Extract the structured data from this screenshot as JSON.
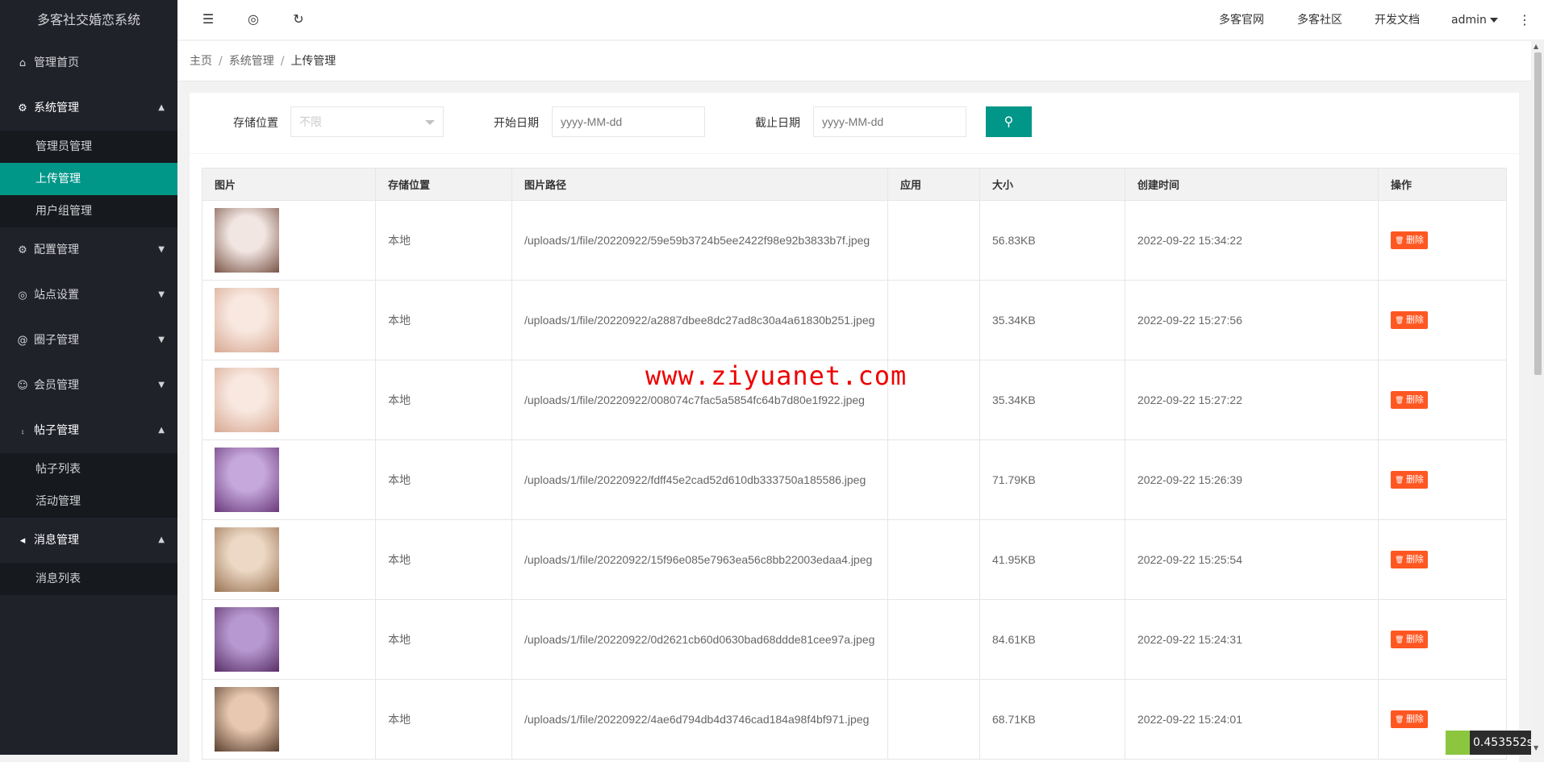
{
  "app": {
    "title": "多客社交婚恋系统"
  },
  "sidebar": {
    "items": [
      {
        "label": "管理首页",
        "icon": "home-icon",
        "expanded": false
      },
      {
        "label": "系统管理",
        "icon": "gear-icon",
        "expanded": true,
        "children": [
          {
            "label": "管理员管理"
          },
          {
            "label": "上传管理",
            "active": true
          },
          {
            "label": "用户组管理"
          }
        ]
      },
      {
        "label": "配置管理",
        "icon": "gear-icon",
        "expanded": false
      },
      {
        "label": "站点设置",
        "icon": "palette-icon",
        "expanded": false
      },
      {
        "label": "圈子管理",
        "icon": "at-icon",
        "expanded": false
      },
      {
        "label": "会员管理",
        "icon": "user-icon",
        "expanded": false
      },
      {
        "label": "帖子管理",
        "icon": "cart-icon",
        "expanded": true,
        "children": [
          {
            "label": "帖子列表"
          },
          {
            "label": "活动管理"
          }
        ]
      },
      {
        "label": "消息管理",
        "icon": "speaker-icon",
        "expanded": true,
        "children": [
          {
            "label": "消息列表"
          }
        ]
      }
    ]
  },
  "header": {
    "links": [
      "多客官网",
      "多客社区",
      "开发文档"
    ],
    "user": "admin"
  },
  "breadcrumb": [
    "主页",
    "系统管理",
    "上传管理"
  ],
  "filters": {
    "storage_label": "存储位置",
    "storage_value": "不限",
    "start_label": "开始日期",
    "start_placeholder": "yyyy-MM-dd",
    "end_label": "截止日期",
    "end_placeholder": "yyyy-MM-dd"
  },
  "table": {
    "columns": [
      "图片",
      "存储位置",
      "图片路径",
      "应用",
      "大小",
      "创建时间",
      "操作"
    ],
    "delete_label": "删除",
    "rows": [
      {
        "storage": "本地",
        "path": "/uploads/1/file/20220922/59e59b3724b5ee2422f98e92b3833b7f.jpeg",
        "app": "",
        "size": "56.83KB",
        "created": "2022-09-22 15:34:22",
        "thumb": [
          "#f2e6e2",
          "#7a5548"
        ]
      },
      {
        "storage": "本地",
        "path": "/uploads/1/file/20220922/a2887dbee8dc27ad8c30a4a61830b251.jpeg",
        "app": "",
        "size": "35.34KB",
        "created": "2022-09-22 15:27:56",
        "thumb": [
          "#f8e8e0",
          "#d8a892"
        ]
      },
      {
        "storage": "本地",
        "path": "/uploads/1/file/20220922/008074c7fac5a5854fc64b7d80e1f922.jpeg",
        "app": "",
        "size": "35.34KB",
        "created": "2022-09-22 15:27:22",
        "thumb": [
          "#f8e8e0",
          "#d8a892"
        ]
      },
      {
        "storage": "本地",
        "path": "/uploads/1/file/20220922/fdff45e2cad52d610db333750a185586.jpeg",
        "app": "",
        "size": "71.79KB",
        "created": "2022-09-22 15:26:39",
        "thumb": [
          "#c6a8dc",
          "#6a3a7a"
        ]
      },
      {
        "storage": "本地",
        "path": "/uploads/1/file/20220922/15f96e085e7963ea56c8bb22003edaa4.jpeg",
        "app": "",
        "size": "41.95KB",
        "created": "2022-09-22 15:25:54",
        "thumb": [
          "#ecd8c4",
          "#9a7454"
        ]
      },
      {
        "storage": "本地",
        "path": "/uploads/1/file/20220922/0d2621cb60d0630bad68ddde81cee97a.jpeg",
        "app": "",
        "size": "84.61KB",
        "created": "2022-09-22 15:24:31",
        "thumb": [
          "#b898d0",
          "#5a3068"
        ]
      },
      {
        "storage": "本地",
        "path": "/uploads/1/file/20220922/4ae6d794db4d3746cad184a98f4bf971.jpeg",
        "app": "",
        "size": "68.71KB",
        "created": "2022-09-22 15:24:01",
        "thumb": [
          "#e8c8b0",
          "#5a4030"
        ]
      }
    ]
  },
  "watermark": "www.ziyuanet.com",
  "timer": "0.453552s",
  "colors": {
    "accent": "#009688",
    "danger": "#ff5722",
    "sidebar_bg": "#20222a"
  }
}
